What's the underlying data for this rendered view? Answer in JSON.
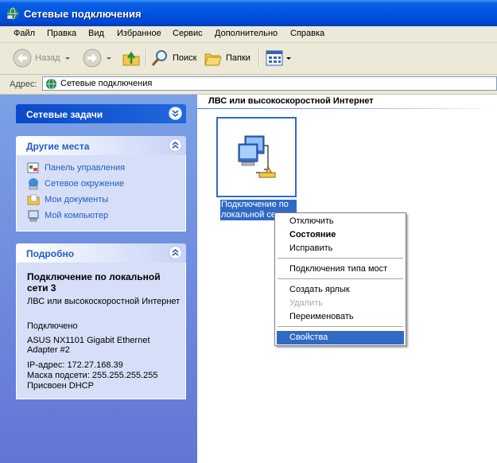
{
  "window": {
    "title": "Сетевые подключения"
  },
  "menu": [
    "Файл",
    "Правка",
    "Вид",
    "Избранное",
    "Сервис",
    "Дополнительно",
    "Справка"
  ],
  "toolbar": {
    "back": "Назад",
    "search": "Поиск",
    "folders": "Папки"
  },
  "address": {
    "label": "Адрес:",
    "value": "Сетевые подключения"
  },
  "tasks": {
    "network_tasks": "Сетевые задачи",
    "other_places": {
      "title": "Другие места",
      "items": [
        "Панель управления",
        "Сетевое окружение",
        "Мои документы",
        "Мой компьютер"
      ]
    },
    "details": {
      "title": "Подробно",
      "name": "Подключение по локальной сети 3",
      "type": "ЛВС или высокоскоростной Интернет",
      "status": "Подключено",
      "adapter": "ASUS NX1101 Gigabit Ethernet Adapter #2",
      "ip": "IP-адрес: 172.27.168.39",
      "mask": "Маска подсети: 255.255.255.255",
      "dhcp": "Присвоен DHCP"
    }
  },
  "content": {
    "group_header": "ЛВС или высокоскоростной Интернет",
    "connection_label_line1": "Подключение по",
    "connection_label_line2": "локальной се"
  },
  "context_menu": [
    "Отключить",
    "Состояние",
    "Исправить",
    "Подключения типа мост",
    "Создать ярлык",
    "Удалить",
    "Переименовать",
    "Свойства"
  ],
  "colors": {
    "title_bar": "#0054e3",
    "highlight": "#316ac5",
    "task_pane": "#6375d6",
    "link": "#215dc6"
  }
}
